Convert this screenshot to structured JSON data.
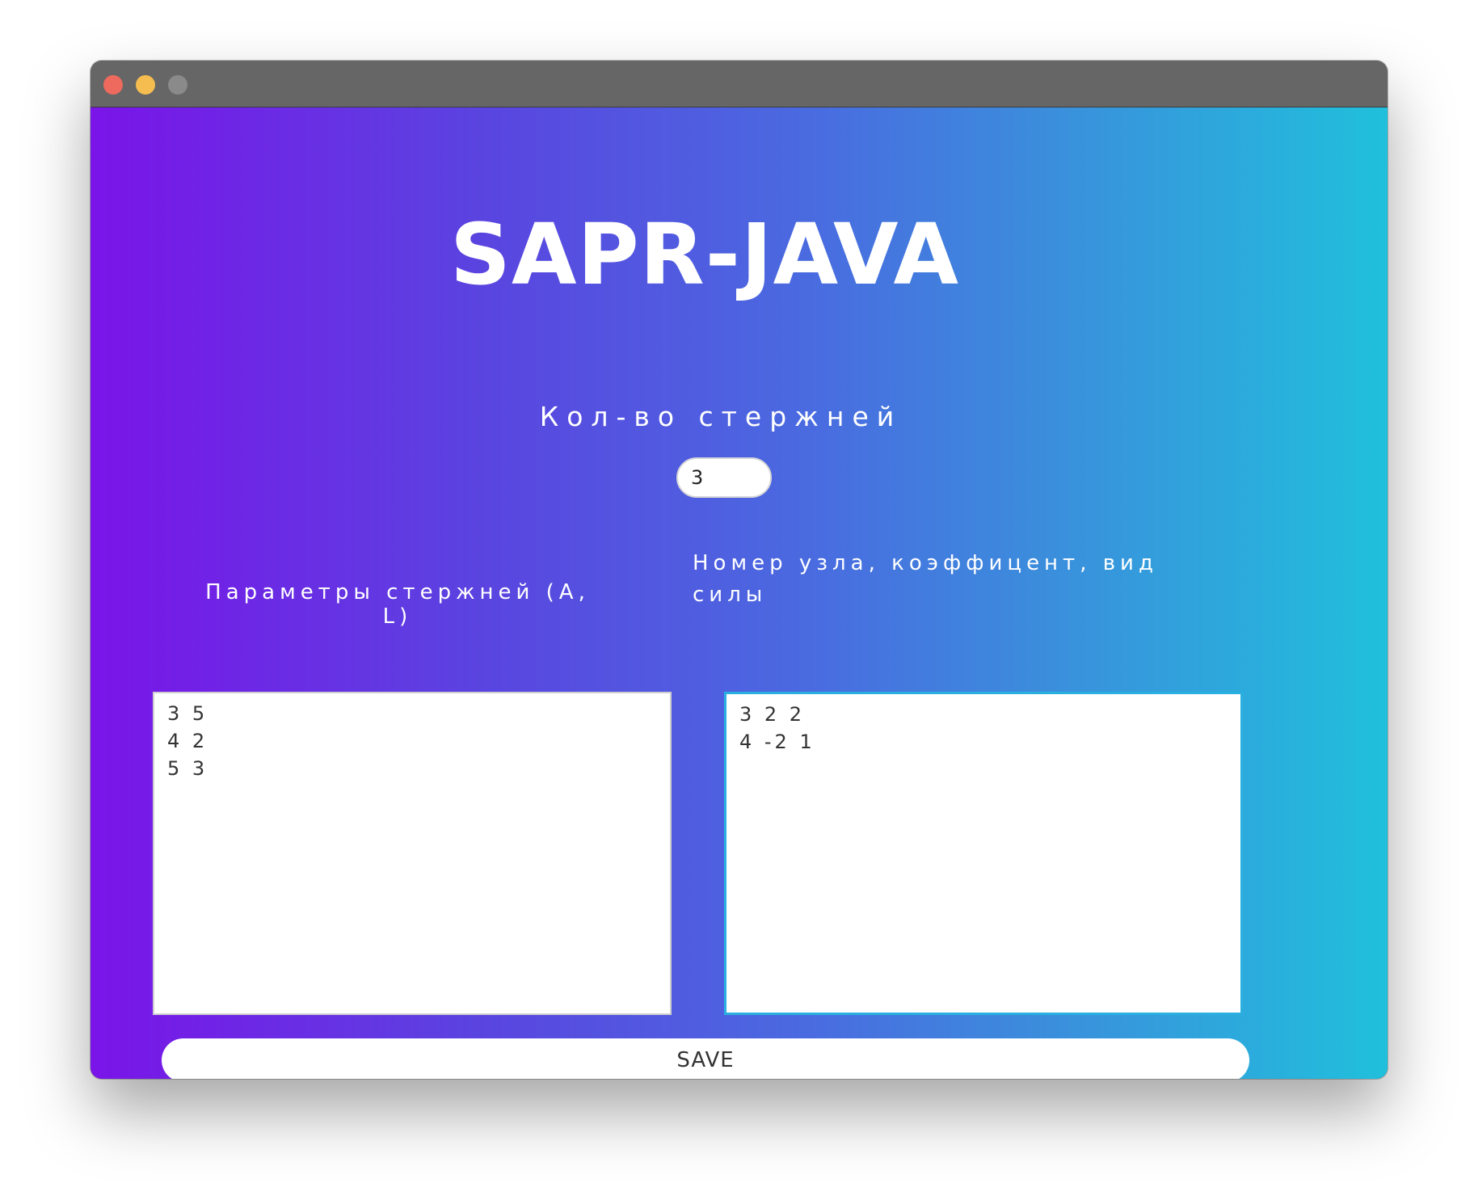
{
  "window": {
    "controls": {
      "close": "close-icon",
      "minimize": "minimize-icon",
      "maximize": "maximize-icon"
    }
  },
  "app": {
    "title": "SAPR-JAVA"
  },
  "count": {
    "label": "Кол-во стержней",
    "value": "3"
  },
  "params": {
    "label": "Параметры стержней (A, L)",
    "value": "3 5\n4 2\n5 3"
  },
  "nodes": {
    "label": "Номер узла, коэффицент, вид силы",
    "value": "3 2 2\n4 -2 1"
  },
  "save": {
    "label": "SAVE"
  },
  "colors": {
    "gradient_start": "#7a14e8",
    "gradient_end": "#20c0dc",
    "focus_border": "#2ab0e0"
  }
}
